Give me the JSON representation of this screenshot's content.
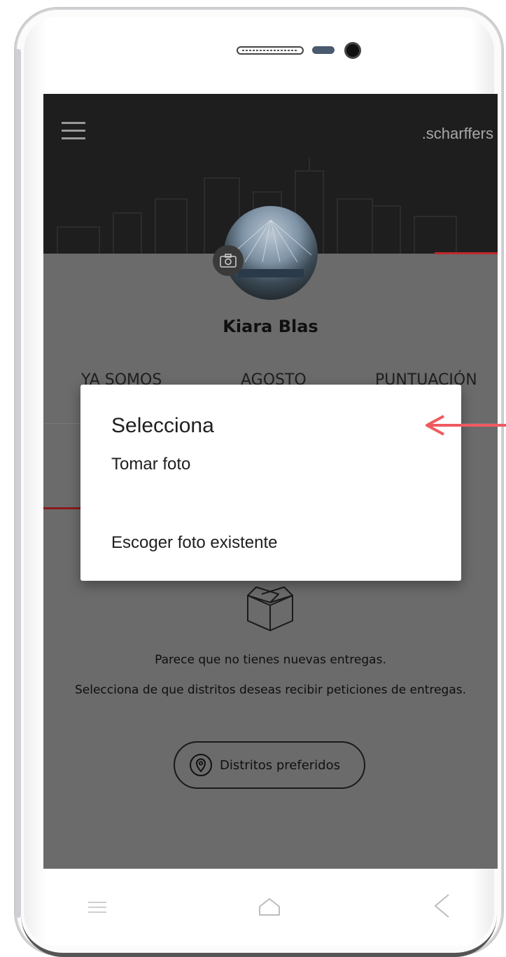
{
  "app": {
    "brand": ".scharffers"
  },
  "profile": {
    "name": "Kiara Blas"
  },
  "stats": {
    "labels": [
      "YA SOMOS",
      "AGOSTO",
      "PUNTUACIÓN"
    ]
  },
  "dialog": {
    "title": "Selecciona",
    "options": [
      "Tomar foto",
      "Escoger foto existente"
    ]
  },
  "empty_state": {
    "message": "Parece que no tienes nuevas entregas.",
    "instruction": "Selecciona de que distritos deseas recibir peticiones de entregas.",
    "button_label": "Distritos preferidos"
  },
  "colors": {
    "header_bg": "#1e1e1e",
    "overlay_bg": "#6b6b6b",
    "accent_red": "#c0282a",
    "arrow": "#ee5a60",
    "dialog_bg": "#ffffff"
  },
  "icons": {
    "menu": "hamburger-icon",
    "camera": "camera-icon",
    "box": "open-box-icon",
    "location": "location-pin-icon",
    "nav_recent": "recent-apps-icon",
    "nav_home": "home-icon",
    "nav_back": "back-icon"
  }
}
